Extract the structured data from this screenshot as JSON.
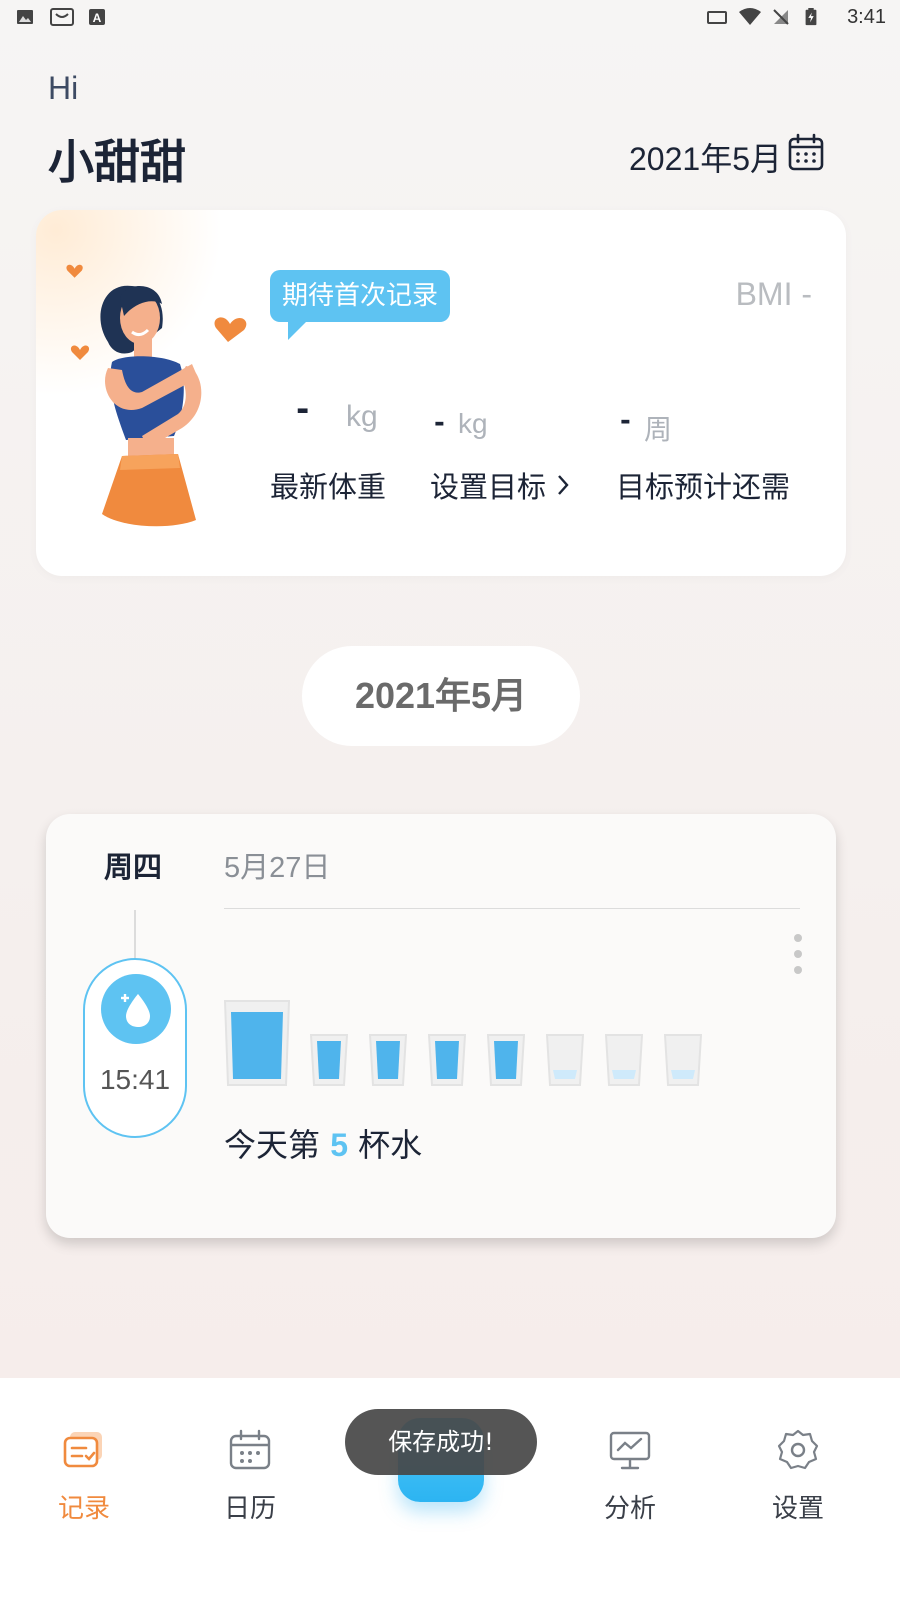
{
  "status_bar": {
    "time": "3:41"
  },
  "header": {
    "greeting": "Hi",
    "username": "小甜甜",
    "date": "2021年5月"
  },
  "weight_card": {
    "bubble_text": "期待首次记录",
    "bmi_text": "BMI -",
    "latest_weight": {
      "value": "-",
      "unit": "kg",
      "label": "最新体重"
    },
    "target_weight": {
      "value": "-",
      "unit": "kg",
      "label": "设置目标"
    },
    "weeks_remaining": {
      "value": "-",
      "unit": "周",
      "label": "目标预计还需"
    }
  },
  "month_pill": "2021年5月",
  "record": {
    "weekday": "周四",
    "date": "5月27日",
    "time": "15:41",
    "water_prefix": "今天第",
    "water_count": "5",
    "water_suffix": "杯水",
    "cups_total": 8,
    "cups_filled": 5
  },
  "bottom_nav": {
    "items": [
      {
        "label": "记录",
        "icon": "record-icon",
        "active": true
      },
      {
        "label": "日历",
        "icon": "calendar-icon",
        "active": false
      },
      {
        "label": "分析",
        "icon": "analysis-icon",
        "active": false
      },
      {
        "label": "设置",
        "icon": "settings-icon",
        "active": false
      }
    ]
  },
  "toast": "保存成功!",
  "colors": {
    "accent_blue": "#5ec3f2",
    "accent_orange": "#f08a3e",
    "dark_text": "#1c2436"
  }
}
